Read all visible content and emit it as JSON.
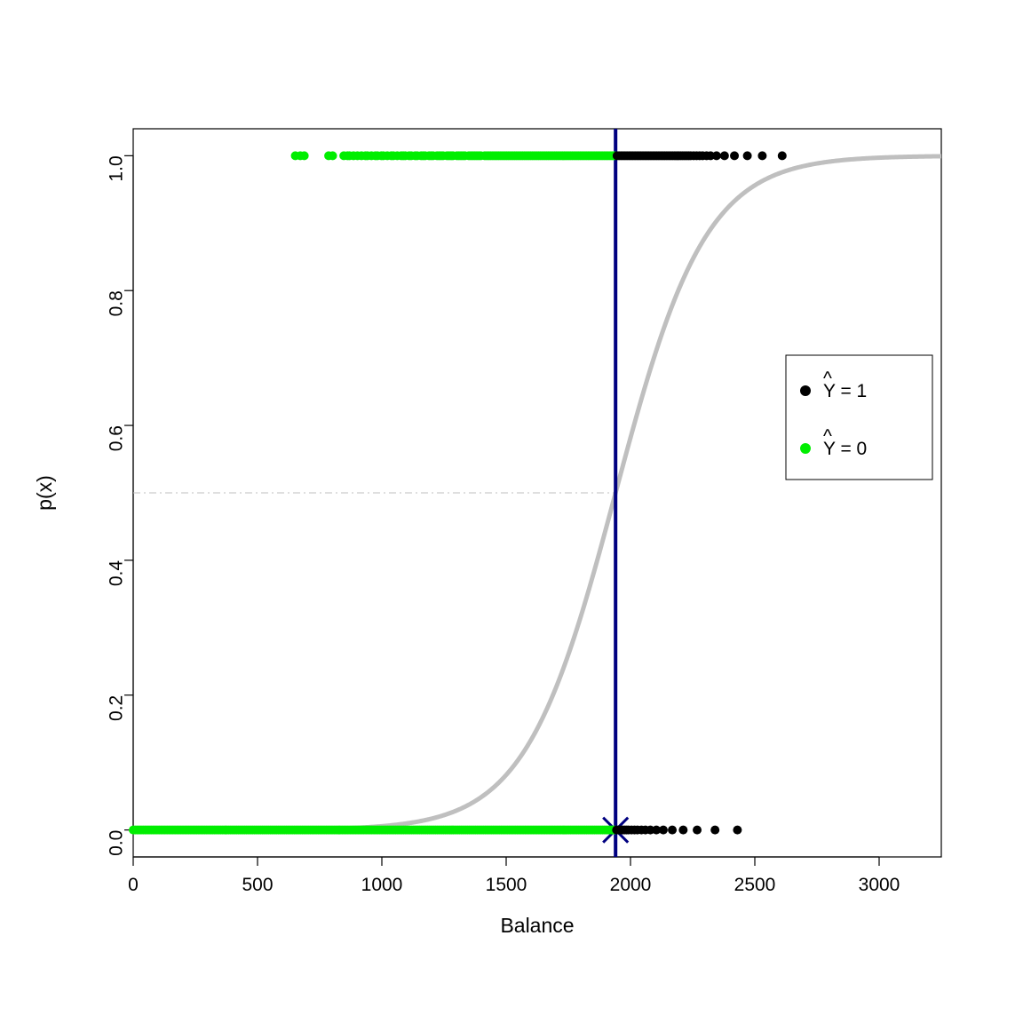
{
  "chart_data": {
    "type": "scatter",
    "xlabel": "Balance",
    "ylabel": "p(x)",
    "xlim": [
      0,
      3250
    ],
    "ylim": [
      -0.04,
      1.04
    ],
    "xticks": [
      0,
      500,
      1000,
      1500,
      2000,
      2500,
      3000
    ],
    "yticks": [
      0.0,
      0.2,
      0.4,
      0.6,
      0.8,
      1.0
    ],
    "threshold_x": 1940,
    "threshold_y": 0.5,
    "logistic_curve": {
      "k": 0.0055,
      "x0": 1940
    },
    "cross_marker": {
      "x": 1940,
      "y": 0.0
    },
    "legend": [
      {
        "label": "Ŷ = 1",
        "color": "#000000"
      },
      {
        "label": "Ŷ = 0",
        "color": "#00ee00"
      }
    ],
    "colors": {
      "green": "#00ee00",
      "black": "#000000",
      "curve": "#bfbfbf",
      "threshold_line": "#000080",
      "dash": "#bfbfbf"
    },
    "points_top_green_x": [
      652,
      672,
      688,
      786,
      802,
      847,
      862,
      870,
      886,
      902,
      918,
      934,
      942,
      958,
      974,
      982,
      998,
      1006,
      1022,
      1038,
      1046,
      1062,
      1078,
      1086,
      1094,
      1110,
      1118,
      1134,
      1142,
      1158,
      1166,
      1174,
      1190,
      1198,
      1206,
      1222,
      1230,
      1238,
      1246,
      1262,
      1270,
      1278,
      1286,
      1302,
      1310,
      1318,
      1326,
      1334,
      1350,
      1358,
      1366,
      1374,
      1382,
      1390,
      1398,
      1414,
      1422,
      1430,
      1438,
      1446,
      1454,
      1462,
      1470,
      1478,
      1486,
      1494,
      1502,
      1510,
      1518,
      1526,
      1534,
      1542,
      1550,
      1558,
      1566,
      1574,
      1582,
      1590,
      1598,
      1606,
      1614,
      1622,
      1630,
      1638,
      1646,
      1654,
      1662,
      1670,
      1678,
      1686,
      1694,
      1702,
      1710,
      1718,
      1726,
      1734,
      1742,
      1750,
      1758,
      1766,
      1774,
      1782,
      1790,
      1798,
      1806,
      1814,
      1822,
      1830,
      1838,
      1846,
      1854,
      1862,
      1870,
      1878,
      1886,
      1894,
      1902,
      1910,
      1918,
      1926,
      1934
    ],
    "points_top_black_x": [
      1946,
      1954,
      1962,
      1970,
      1978,
      1986,
      1994,
      2002,
      2010,
      2018,
      2026,
      2034,
      2042,
      2050,
      2058,
      2066,
      2074,
      2082,
      2090,
      2098,
      2106,
      2114,
      2122,
      2130,
      2138,
      2146,
      2154,
      2162,
      2170,
      2178,
      2186,
      2194,
      2202,
      2210,
      2218,
      2226,
      2234,
      2242,
      2254,
      2266,
      2278,
      2290,
      2306,
      2322,
      2346,
      2378,
      2418,
      2470,
      2530,
      2610
    ],
    "points_bottom_green_x": [
      0,
      8,
      16,
      24,
      32,
      40,
      48,
      56,
      64,
      72,
      80,
      88,
      96,
      104,
      112,
      120,
      128,
      136,
      144,
      152,
      160,
      168,
      176,
      184,
      192,
      200,
      208,
      216,
      224,
      232,
      240,
      248,
      256,
      264,
      272,
      280,
      288,
      296,
      304,
      312,
      320,
      328,
      336,
      344,
      352,
      360,
      368,
      376,
      384,
      392,
      400,
      408,
      416,
      424,
      432,
      440,
      448,
      456,
      464,
      472,
      480,
      488,
      496,
      504,
      512,
      520,
      528,
      536,
      544,
      552,
      560,
      568,
      576,
      584,
      592,
      600,
      608,
      616,
      624,
      632,
      640,
      648,
      656,
      664,
      672,
      680,
      688,
      696,
      704,
      712,
      720,
      728,
      736,
      744,
      752,
      760,
      768,
      776,
      784,
      792,
      800,
      808,
      816,
      824,
      832,
      840,
      848,
      856,
      864,
      872,
      880,
      888,
      896,
      904,
      912,
      920,
      928,
      936,
      944,
      952,
      960,
      968,
      976,
      984,
      992,
      1000,
      1008,
      1016,
      1024,
      1032,
      1040,
      1048,
      1056,
      1064,
      1072,
      1080,
      1088,
      1096,
      1104,
      1112,
      1120,
      1128,
      1136,
      1144,
      1152,
      1160,
      1168,
      1176,
      1184,
      1192,
      1200,
      1208,
      1216,
      1224,
      1232,
      1240,
      1248,
      1256,
      1264,
      1272,
      1280,
      1288,
      1296,
      1304,
      1312,
      1320,
      1328,
      1336,
      1344,
      1352,
      1360,
      1368,
      1376,
      1384,
      1392,
      1400,
      1408,
      1416,
      1424,
      1432,
      1440,
      1448,
      1456,
      1464,
      1472,
      1480,
      1488,
      1496,
      1504,
      1512,
      1520,
      1528,
      1536,
      1544,
      1552,
      1560,
      1568,
      1576,
      1584,
      1592,
      1600,
      1608,
      1616,
      1624,
      1632,
      1640,
      1648,
      1656,
      1664,
      1672,
      1680,
      1688,
      1696,
      1704,
      1712,
      1720,
      1728,
      1736,
      1744,
      1752,
      1760,
      1768,
      1776,
      1784,
      1792,
      1800,
      1808,
      1816,
      1824,
      1832,
      1840,
      1848,
      1856,
      1864,
      1872,
      1880,
      1888,
      1896,
      1904,
      1912,
      1920,
      1928,
      1936
    ],
    "points_bottom_black_x": [
      1944,
      1952,
      1960,
      1968,
      1976,
      1984,
      1992,
      2004,
      2016,
      2028,
      2044,
      2060,
      2080,
      2104,
      2132,
      2168,
      2212,
      2268,
      2340,
      2430
    ]
  }
}
